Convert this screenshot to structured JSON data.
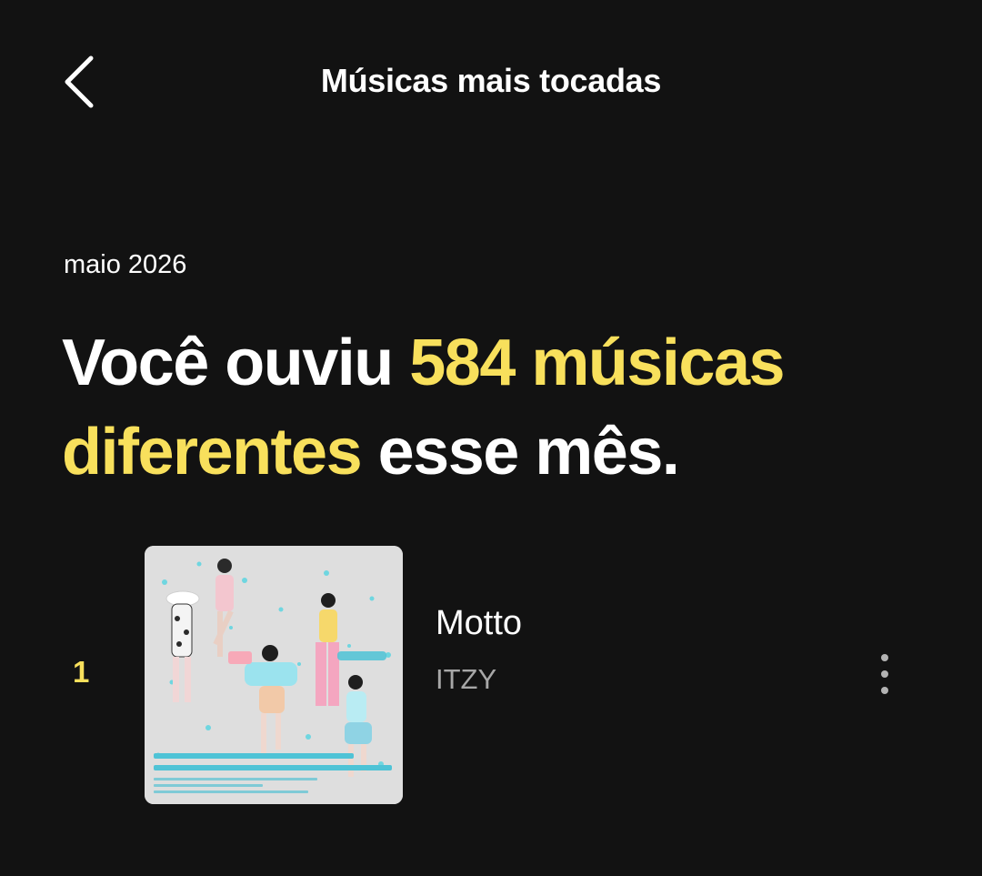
{
  "header": {
    "title": "Músicas mais tocadas",
    "back_icon": "chevron-left-icon"
  },
  "period": "maio 2026",
  "headline": {
    "part1": "Você ouviu ",
    "highlight1": "584 músicas",
    "highlight2": "diferentes",
    "part2": " esse mês."
  },
  "colors": {
    "background": "#121212",
    "accent": "#f8e05c",
    "secondary_text": "#a7a7a7"
  },
  "tracks": [
    {
      "rank": "1",
      "title": "Motto",
      "artist": "ITZY",
      "cover_icon": "album-cover",
      "more_icon": "more-vertical-icon"
    }
  ]
}
